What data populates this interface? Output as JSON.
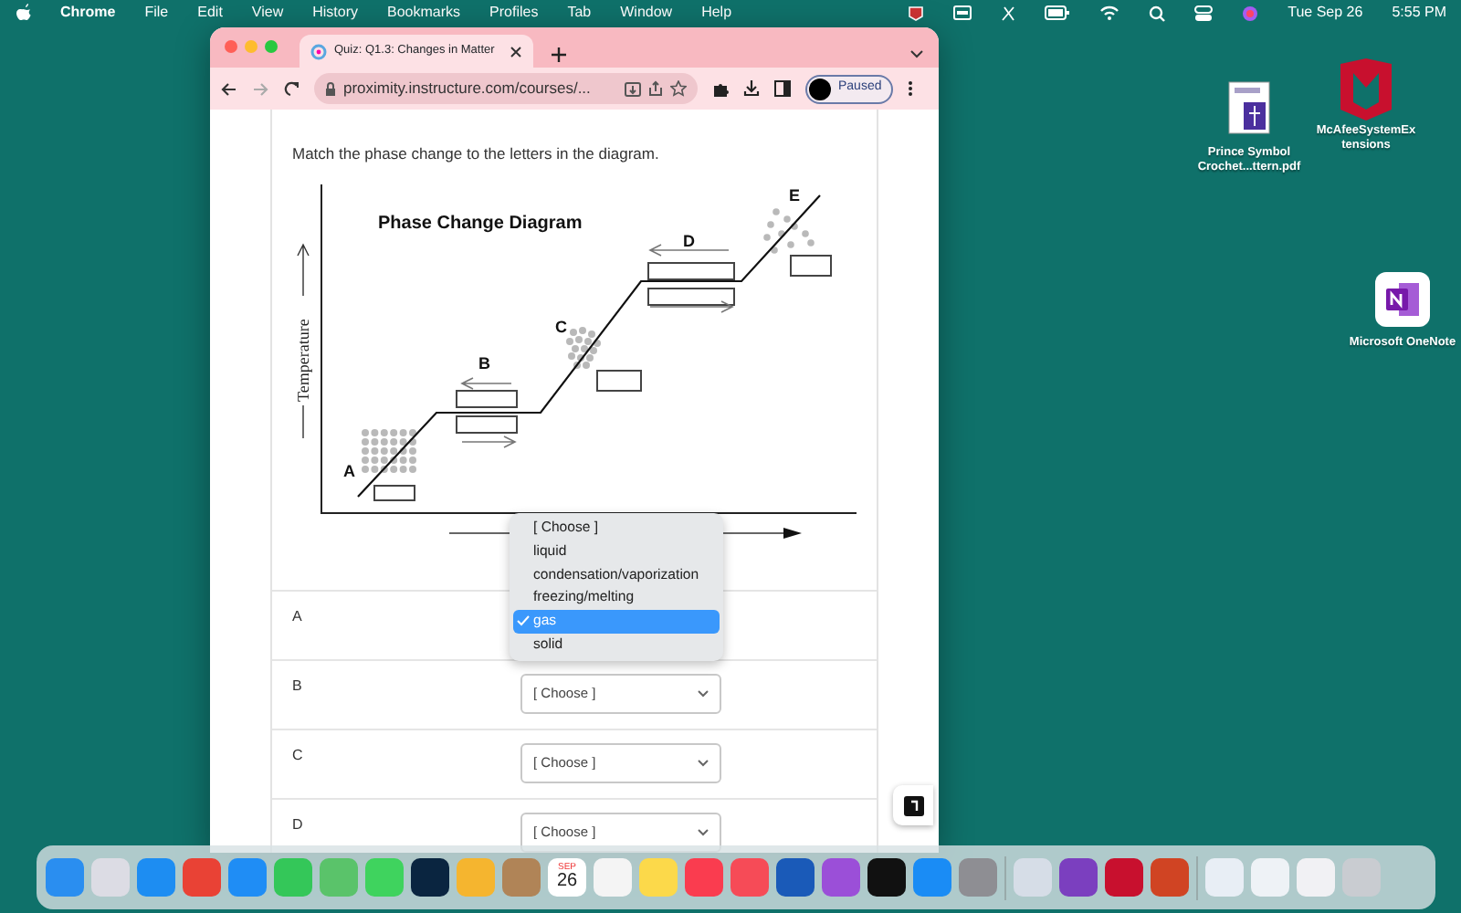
{
  "menubar": {
    "app": "Chrome",
    "items": [
      "File",
      "Edit",
      "View",
      "History",
      "Bookmarks",
      "Profiles",
      "Tab",
      "Window",
      "Help"
    ],
    "date": "Tue Sep 26",
    "time": "5:55 PM"
  },
  "browser": {
    "tab_title": "Quiz: Q1.3: Changes in Matter",
    "url": "proximity.instructure.com/courses/...",
    "profile_status": "Paused"
  },
  "question": "Match the phase change to the letters in the diagram.",
  "diagram": {
    "title": "Phase Change Diagram",
    "axis_label": "Temperature",
    "points": [
      {
        "label": "A",
        "kind": "solid"
      },
      {
        "label": "B",
        "kind": "plateau"
      },
      {
        "label": "C",
        "kind": "liquid"
      },
      {
        "label": "D",
        "kind": "plateau"
      },
      {
        "label": "E",
        "kind": "gas"
      }
    ]
  },
  "rows": [
    {
      "label": "A",
      "kind": "open",
      "options": [
        {
          "label": "[ Choose ]",
          "selected": false
        },
        {
          "label": "liquid",
          "selected": false
        },
        {
          "label": "condensation/vaporization",
          "selected": false
        },
        {
          "label": "freezing/melting",
          "selected": false
        },
        {
          "label": "gas",
          "selected": true
        },
        {
          "label": "solid",
          "selected": false
        }
      ]
    },
    {
      "label": "B",
      "kind": "closed",
      "value": "[ Choose ]"
    },
    {
      "label": "C",
      "kind": "closed",
      "value": "[ Choose ]"
    },
    {
      "label": "D",
      "kind": "closed",
      "value": "[ Choose ]"
    }
  ],
  "desktop_icons": [
    {
      "label": "Prince Symbol Crochet...ttern.pdf",
      "kind": "pdf"
    },
    {
      "label": "McAfeeSystemExtensions",
      "kind": "shield"
    },
    {
      "label": "Microsoft OneNote",
      "kind": "onenote"
    }
  ],
  "dock": [
    {
      "kind": "app",
      "color": "#2a8ef0"
    },
    {
      "kind": "app",
      "color": "#dcdce4"
    },
    {
      "kind": "app",
      "color": "#1d8df2"
    },
    {
      "kind": "app",
      "color": "#e94235"
    },
    {
      "kind": "app",
      "color": "#1f8df5"
    },
    {
      "kind": "app",
      "color": "#34c759"
    },
    {
      "kind": "app",
      "color": "#5ac36a"
    },
    {
      "kind": "app",
      "color": "#3fd35e"
    },
    {
      "kind": "app",
      "color": "#0a2540"
    },
    {
      "kind": "app",
      "color": "#f5b52f"
    },
    {
      "kind": "app",
      "color": "#b08457"
    },
    {
      "kind": "calendar",
      "month": "SEP",
      "day": "26"
    },
    {
      "kind": "app",
      "color": "#f4f4f4"
    },
    {
      "kind": "app",
      "color": "#fcd94a"
    },
    {
      "kind": "app",
      "color": "#fa3c4f"
    },
    {
      "kind": "app",
      "color": "#f64b57"
    },
    {
      "kind": "app",
      "color": "#1a5ab8"
    },
    {
      "kind": "app",
      "color": "#9b4fd8"
    },
    {
      "kind": "app",
      "color": "#111111"
    },
    {
      "kind": "app",
      "color": "#1a8cf5"
    },
    {
      "kind": "app",
      "color": "#8e8e93"
    },
    {
      "kind": "separator"
    },
    {
      "kind": "app",
      "color": "#d6dde7"
    },
    {
      "kind": "app",
      "color": "#7b3fbf"
    },
    {
      "kind": "app",
      "color": "#c8102e"
    },
    {
      "kind": "app",
      "color": "#d04423"
    },
    {
      "kind": "separator"
    },
    {
      "kind": "app",
      "color": "#e8eef5"
    },
    {
      "kind": "app",
      "color": "#eef2f6"
    },
    {
      "kind": "app",
      "color": "#f1f1f4"
    },
    {
      "kind": "app",
      "color": "#c9ccd1"
    }
  ]
}
